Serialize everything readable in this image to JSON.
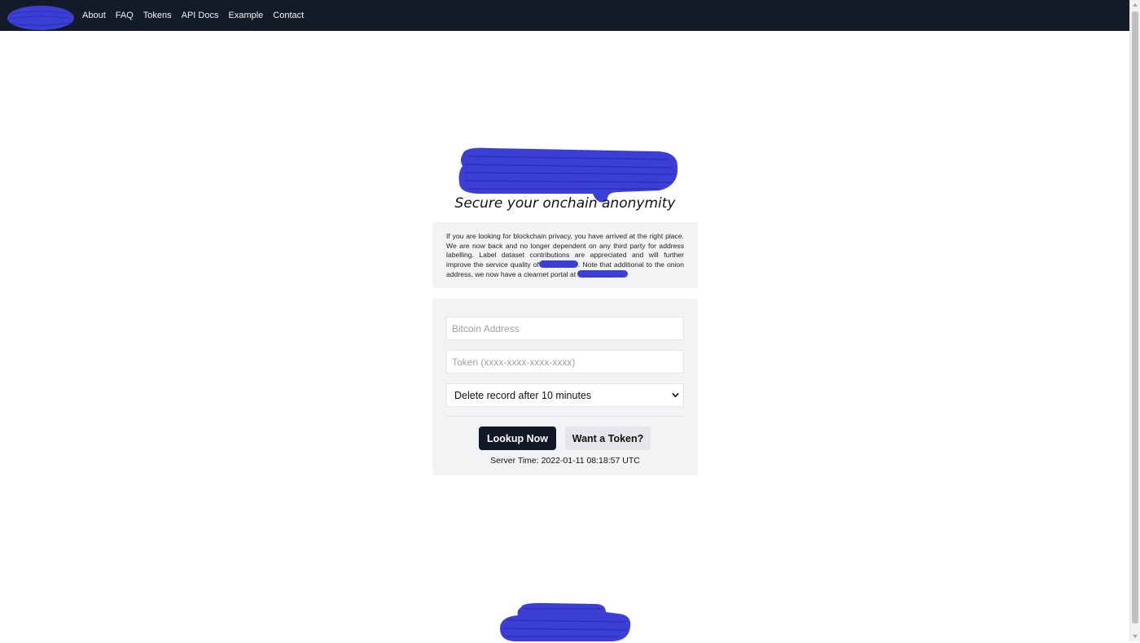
{
  "nav": {
    "links": [
      "About",
      "FAQ",
      "Tokens",
      "API Docs",
      "Example",
      "Contact"
    ]
  },
  "hero": {
    "tagline": "Secure your onchain anonymity"
  },
  "info": {
    "part1": "If you are looking for blockchain privacy, you have arrived at the right place. We are now back and no longer dependent on any third party for address labelling. Label dataset contributions are appreciated and will further improve the service quality of",
    "part2": ". Note that additional to the onion address, we now have a clearnet portal at"
  },
  "form": {
    "address_placeholder": "Bitcoin Address",
    "token_placeholder": "Token (xxxx-xxxx-xxxx-xxxx)",
    "delete_option": "Delete record after 10 minutes",
    "lookup_label": "Lookup Now",
    "want_token_label": "Want a Token?",
    "server_time": "Server Time: 2022-01-11 08:18:57 UTC"
  },
  "colors": {
    "navbar": "#131a28",
    "redaction": "#3c3fd6",
    "card": "#f2f3f5",
    "primary_button": "#121826"
  },
  "icons": {
    "select": "chevron-down-icon"
  }
}
